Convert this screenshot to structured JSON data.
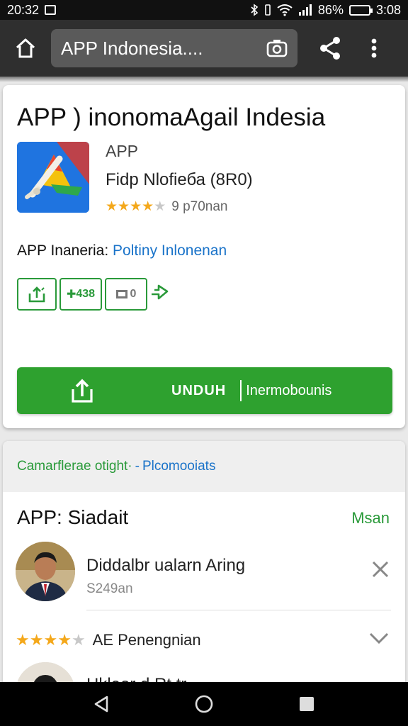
{
  "status": {
    "time": "20:32",
    "battery": "86%",
    "battery_level": 0.86,
    "clock_right": "3:08"
  },
  "toolbar": {
    "url_text": "APP Indonesia....",
    "icons": [
      "home-icon",
      "camera-icon",
      "share-icon",
      "more-vert-icon"
    ]
  },
  "app": {
    "title": "APP ) inonomaAgail Indesia",
    "label": "APP",
    "developer": "Fidp Nlofiеба (8R0)",
    "rating_value": 3.5,
    "rating_text": "9 p70nan",
    "description_prefix": "APP Inanеria:",
    "description_link": "Poltiny Inlonenan",
    "chips": {
      "count_label": "438",
      "box_label": "0"
    },
    "download_label": "UNDUH",
    "download_sub": "Inermobounis"
  },
  "colors": {
    "accent_green": "#2ea12f",
    "link_blue": "#1a73c9",
    "star": "#f4a81b",
    "toolbar": "#2f2f2f"
  },
  "promo": {
    "green_text": "Camarflerae otight·",
    "separator": "-",
    "blue_text": "Plcomooiats"
  },
  "reviews": {
    "section_title": "APP: Siadait",
    "more_label": "Msan",
    "items": [
      {
        "name": "Diddalbr ualarn Aring",
        "date": "S249an"
      }
    ],
    "rating_value": 4,
    "rating_text": "AE Penengnian",
    "partial_name": "Hkleor d Rt tr"
  }
}
